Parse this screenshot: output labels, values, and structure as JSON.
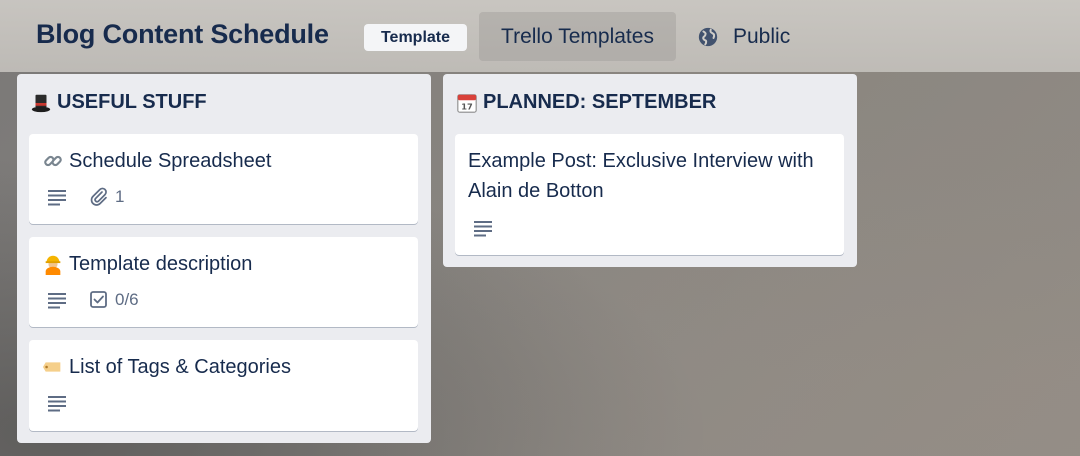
{
  "header": {
    "board_title": "Blog Content Schedule",
    "template_badge": "Template",
    "workspace": "Trello Templates",
    "visibility": "Public"
  },
  "lists": [
    {
      "name": "USEFUL STUFF",
      "emoji": "top-hat",
      "cards": [
        {
          "title": "Schedule Spreadsheet",
          "emoji": "link-icon",
          "has_description": true,
          "attachments": "1"
        },
        {
          "title": "Template description",
          "emoji": "construction-worker-icon",
          "has_description": true,
          "checklist": "0/6"
        },
        {
          "title": "List of Tags & Categories",
          "emoji": "tag-label-icon",
          "has_description": true
        }
      ]
    },
    {
      "name": "PLANNED: SEPTEMBER",
      "emoji": "calendar-icon",
      "cards": [
        {
          "title": "Example Post: Exclusive Interview with Alain de Botton",
          "has_description": true
        }
      ]
    }
  ],
  "colors": {
    "text": "#172b4d",
    "list_bg": "#ebecf0",
    "card_bg": "#ffffff",
    "muted": "#5e6c84"
  }
}
